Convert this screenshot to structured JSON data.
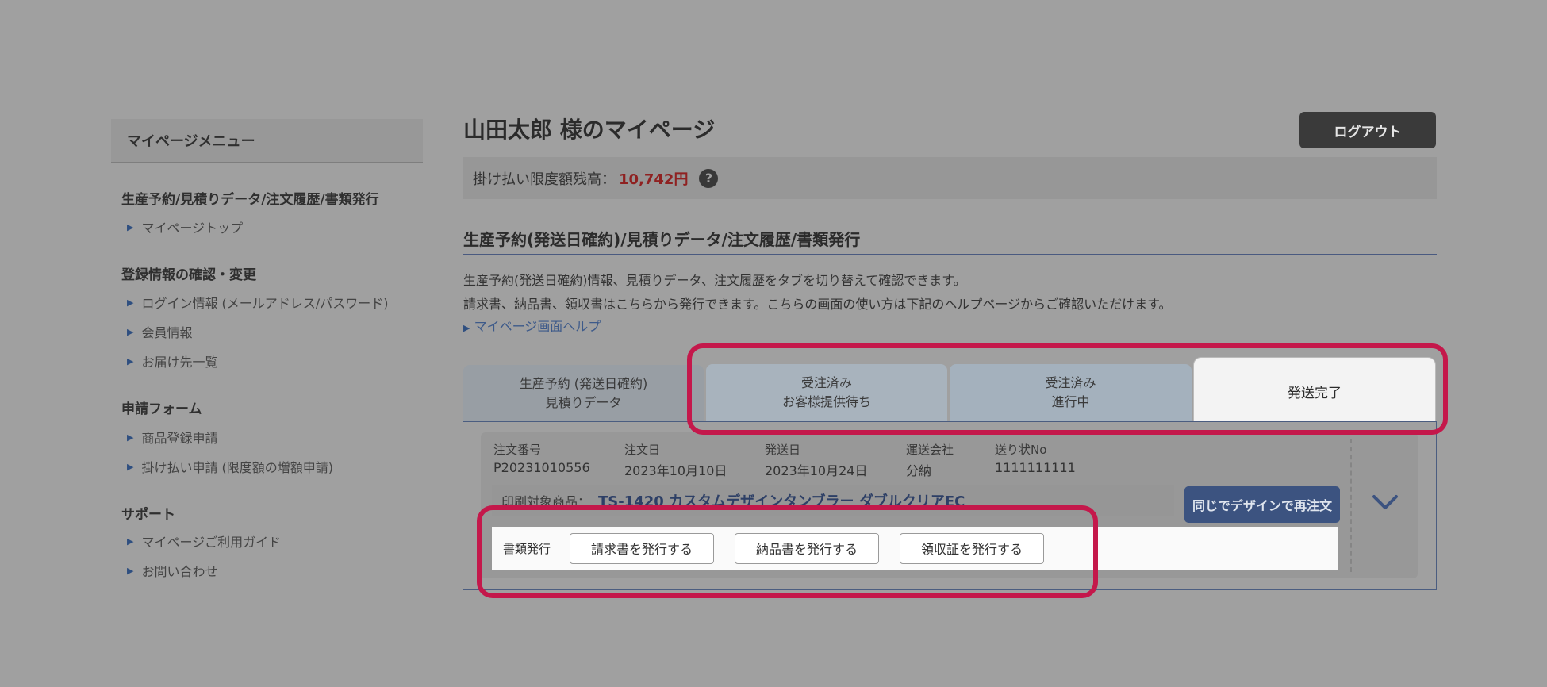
{
  "sidebar": {
    "title": "マイページメニュー",
    "sections": [
      {
        "title": "生産予約/見積りデータ/注文履歴/書類発行",
        "items": [
          "マイページトップ"
        ]
      },
      {
        "title": "登録情報の確認・変更",
        "items": [
          "ログイン情報 (メールアドレス/パスワード)",
          "会員情報",
          "お届け先一覧"
        ]
      },
      {
        "title": "申請フォーム",
        "items": [
          "商品登録申請",
          "掛け払い申請 (限度額の増額申請)"
        ]
      },
      {
        "title": "サポート",
        "items": [
          "マイページご利用ガイド",
          "お問い合わせ"
        ]
      }
    ]
  },
  "header": {
    "title": "山田太郎 様のマイページ",
    "logout_label": "ログアウト",
    "credit_label": "掛け払い限度額残高：",
    "credit_amount": "10,742円",
    "help_mark": "?"
  },
  "section": {
    "title": "生産予約(発送日確約)/見積りデータ/注文履歴/書類発行",
    "desc1": "生産予約(発送日確約)情報、見積りデータ、注文履歴をタブを切り替えて確認できます。",
    "desc2": "請求書、納品書、領収書はこちらから発行できます。こちらの画面の使い方は下記のヘルプページからご確認いただけます。",
    "help_link": "マイページ画面ヘルプ"
  },
  "tabs": [
    {
      "line1": "生産予約 (発送日確約)",
      "line2": "見積りデータ"
    },
    {
      "line1": "受注済み",
      "line2": "お客様提供待ち"
    },
    {
      "line1": "受注済み",
      "line2": "進行中"
    },
    {
      "line1": "発送完了",
      "line2": ""
    }
  ],
  "order": {
    "columns": [
      {
        "label": "注文番号",
        "value": "P20231010556"
      },
      {
        "label": "注文日",
        "value": "2023年10月10日"
      },
      {
        "label": "発送日",
        "value": "2023年10月24日"
      },
      {
        "label": "運送会社",
        "value": "分納"
      },
      {
        "label": "送り状No",
        "value": "1111111111"
      }
    ],
    "product_label": "印刷対象商品：",
    "product_name": "TS-1420 カスタムデザインタンブラー ダブルクリアEC",
    "reorder_label": "同じでデザインで再注文"
  },
  "documents": {
    "label": "書類発行",
    "buttons": [
      "請求書を発行する",
      "納品書を発行する",
      "領収証を発行する"
    ]
  },
  "colors": {
    "highlight": "#c4184b",
    "accent": "#3c5380",
    "amount": "#8f2121"
  }
}
